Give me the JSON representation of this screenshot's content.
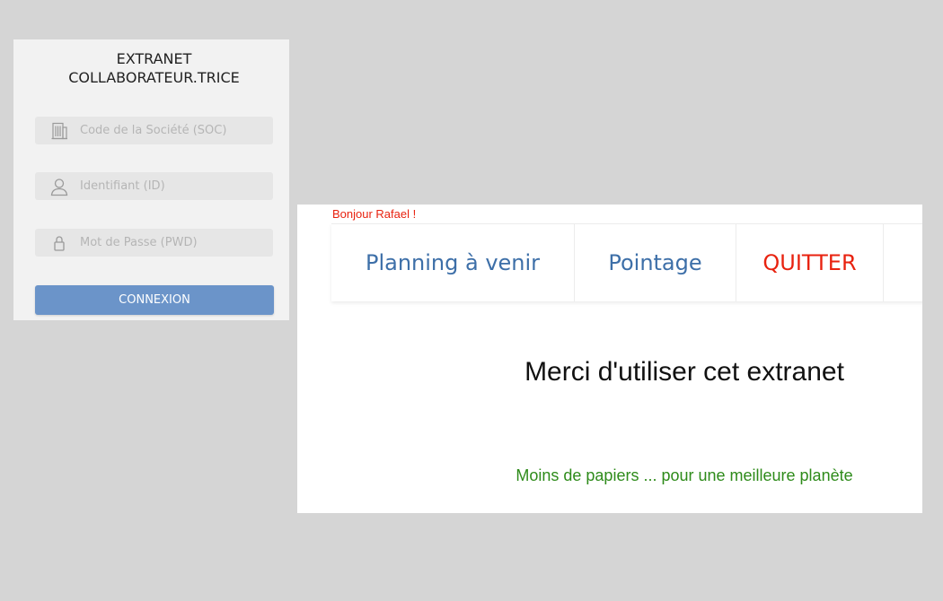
{
  "login": {
    "title_line1": "EXTRANET",
    "title_line2": "COLLABORATEUR.TRICE",
    "fields": [
      {
        "name": "soc",
        "placeholder": "Code de la Société (SOC)",
        "value": "",
        "icon": "building-icon"
      },
      {
        "name": "id",
        "placeholder": "Identifiant (ID)",
        "value": "",
        "icon": "user-icon"
      },
      {
        "name": "pwd",
        "placeholder": "Mot de Passe (PWD)",
        "value": "",
        "icon": "lock-icon"
      }
    ],
    "button_label": "CONNEXION"
  },
  "main": {
    "greeting": "Bonjour Rafael !",
    "nav": [
      {
        "label": "Planning à venir"
      },
      {
        "label": "Pointage"
      },
      {
        "label": "QUITTER"
      }
    ],
    "title": "Merci d'utiliser cet extranet",
    "slogan": "Moins de papiers ... pour une meilleure planète"
  },
  "colors": {
    "page_background": "#d5d5d5",
    "login_background": "#f2f2f2",
    "field_background": "#e6e6e6",
    "button_blue": "#6b94c9",
    "nav_blue": "#3d6fa8",
    "quit_red": "#e8220f",
    "slogan_green": "#2e8b1a"
  }
}
